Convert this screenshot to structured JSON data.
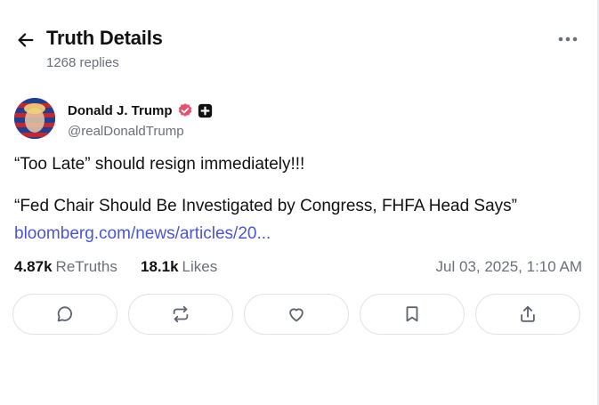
{
  "header": {
    "title": "Truth Details",
    "replies": "1268 replies",
    "back_icon": "arrow-left-icon",
    "more_icon": "more-horizontal-icon"
  },
  "post": {
    "author": {
      "name": "Donald J. Trump",
      "handle": "@realDonaldTrump",
      "verified_icon": "verified-badge-icon",
      "verified_color": "#e7506f",
      "extra_badge_icon": "plus-square-badge-icon"
    },
    "text": [
      "“Too Late” should resign immediately!!!",
      "“Fed Chair Should Be Investigated by Congress, FHFA Head Says”"
    ],
    "link": "bloomberg.com/news/articles/20...",
    "link_color": "#4a55d6",
    "stats": {
      "retruths_count": "4.87k",
      "retruths_label": "ReTruths",
      "likes_count": "18.1k",
      "likes_label": "Likes"
    },
    "timestamp": "Jul 03, 2025, 1:10 AM"
  },
  "actions": [
    {
      "name": "reply",
      "icon": "comment-bubble-icon"
    },
    {
      "name": "retruth",
      "icon": "repost-arrows-icon"
    },
    {
      "name": "like",
      "icon": "heart-icon"
    },
    {
      "name": "bookmark",
      "icon": "bookmark-icon"
    },
    {
      "name": "share",
      "icon": "share-upload-icon"
    }
  ],
  "colors": {
    "text_primary": "#111111",
    "text_secondary": "#6b6f7b",
    "border": "#e2e3ea"
  }
}
